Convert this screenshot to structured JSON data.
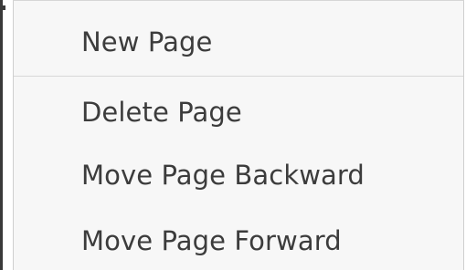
{
  "menu": {
    "items": [
      {
        "label": "New Page"
      },
      {
        "label": "Delete Page"
      },
      {
        "label": "Move Page Backward"
      },
      {
        "label": "Move Page Forward"
      }
    ]
  },
  "colors": {
    "menu_background": "#f7f7f7",
    "text": "#3c3c3c",
    "separator": "#d8d8d8"
  }
}
